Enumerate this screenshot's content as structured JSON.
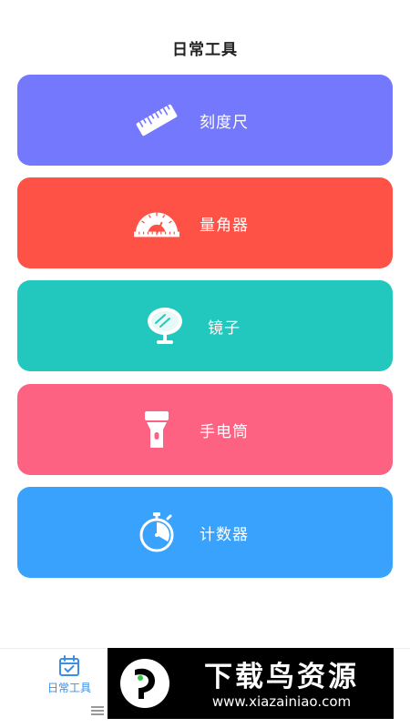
{
  "page": {
    "title": "日常工具"
  },
  "tools": [
    {
      "label": "刻度尺",
      "icon": "ruler-icon",
      "color": "#7478fd"
    },
    {
      "label": "量角器",
      "icon": "protractor-icon",
      "color": "#fd5245"
    },
    {
      "label": "镜子",
      "icon": "mirror-icon",
      "color": "#22c8bd"
    },
    {
      "label": "手电筒",
      "icon": "flashlight-icon",
      "color": "#fe6283"
    },
    {
      "label": "计数器",
      "icon": "stopwatch-icon",
      "color": "#39a2fc"
    }
  ],
  "tab_bar": {
    "active_tab_label": "日常工具",
    "active_tab_icon": "calendar-check-icon",
    "accent_color": "#3a8ee6"
  },
  "watermark": {
    "name": "下载鸟资源",
    "url": "www.xiazainiao.com"
  }
}
